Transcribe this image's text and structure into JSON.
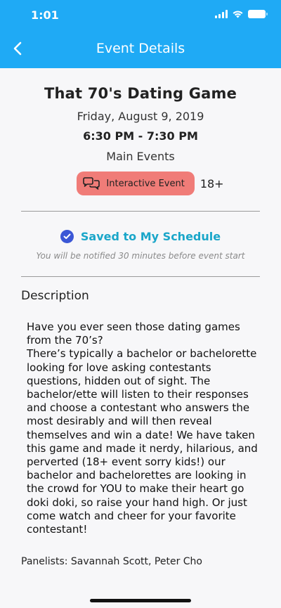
{
  "status_bar": {
    "time": "1:01"
  },
  "header": {
    "title": "Event Details",
    "back_icon": "chevron-left-icon"
  },
  "event": {
    "title": "That 70's Dating Game",
    "date": "Friday, August 9, 2019",
    "time": "6:30 PM - 7:30 PM",
    "category": "Main Events",
    "tag": {
      "label": "Interactive Event",
      "icon": "chat-bubbles-icon",
      "color": "#f07c78"
    },
    "age": "18+"
  },
  "schedule": {
    "saved_label": "Saved to My Schedule",
    "notice": "You will be notified 30 minutes before event start",
    "accent": "#1aa6c9",
    "check_color": "#3b57d6"
  },
  "description": {
    "heading": "Description",
    "body": "Have you ever seen those dating games from the 70’s?\nThere’s typically a bachelor or bachelorette looking for love asking contestants questions, hidden out of sight. The bachelor/ette will listen to their responses and choose a contestant who answers the most desirably and will then reveal themselves and win a date! We have taken this game and made it nerdy, hilarious, and perverted (18+ event sorry kids!) our bachelor and bachelorettes are looking in the crowd for YOU to make their heart go doki doki, so raise your hand high. Or just come watch and cheer for your favorite contestant!",
    "panelists": "Panelists: Savannah Scott, Peter Cho"
  },
  "colors": {
    "header": "#1faaf5",
    "background": "#f7f7f9"
  }
}
